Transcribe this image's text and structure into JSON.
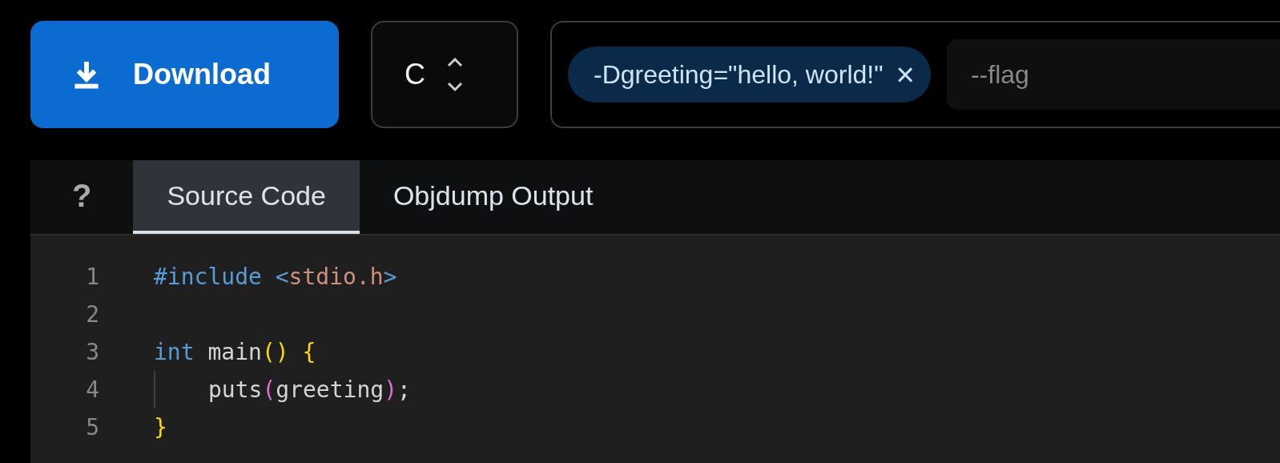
{
  "toolbar": {
    "download_label": "Download",
    "language": "C",
    "flags": [
      {
        "text": "-Dgreeting=\"hello, world!\"",
        "remove": "×"
      }
    ],
    "flag_input": {
      "placeholder": "--flag"
    }
  },
  "tabs": [
    {
      "label": "?",
      "kind": "help",
      "selected": false
    },
    {
      "label": "Source Code",
      "kind": "text",
      "selected": true
    },
    {
      "label": "Objdump Output",
      "kind": "text",
      "selected": false
    }
  ],
  "editor": {
    "lines": [
      {
        "number": "1",
        "tokens": [
          {
            "kind": "keyword",
            "text": "#include"
          },
          {
            "kind": "keyword",
            "text": " <"
          },
          {
            "kind": "string",
            "text": "stdio.h"
          },
          {
            "kind": "keyword",
            "text": ">"
          }
        ]
      },
      {
        "number": "2"
      },
      {
        "number": "3",
        "tokens": [
          {
            "kind": "keyword",
            "text": "int"
          },
          {
            "kind": "plain",
            "text": " main"
          },
          {
            "kind": "bracket1",
            "text": "()"
          },
          {
            "kind": "bracket1",
            "text": " {"
          }
        ]
      },
      {
        "number": "4",
        "indent": true,
        "tokens": [
          {
            "kind": "plain",
            "text": "puts"
          },
          {
            "kind": "bracket2",
            "text": "("
          },
          {
            "kind": "plain",
            "text": "greeting"
          },
          {
            "kind": "bracket2",
            "text": ")"
          },
          {
            "kind": "plain",
            "text": ";"
          }
        ]
      },
      {
        "number": "5",
        "tokens": [
          {
            "kind": "bracket1",
            "text": "}"
          }
        ]
      }
    ]
  }
}
